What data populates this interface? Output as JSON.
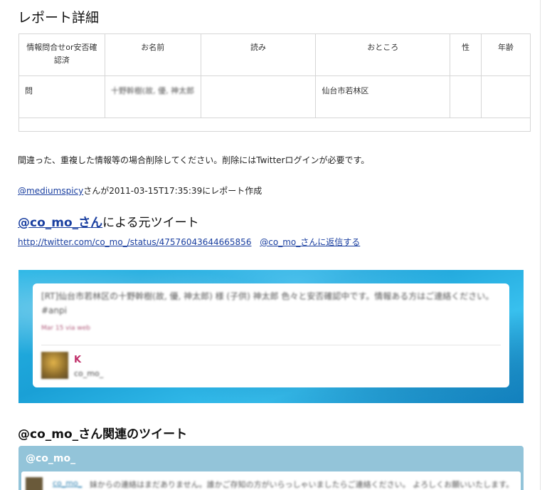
{
  "page_title": "レポート詳細",
  "report_table": {
    "headers": [
      "情報問合せor安否確認済",
      "お名前",
      "読み",
      "おところ",
      "性",
      "年齢"
    ],
    "row": [
      "問",
      "十野幹樹(故, 優, 神太郎",
      "",
      "仙台市若林区",
      "",
      ""
    ]
  },
  "note": "間違った、重複した情報等の場合削除してください。削除にはTwitterログインが必要です。",
  "byline": {
    "user": "@mediumspicy",
    "suffix": "さんが2011-03-15T17:35:39にレポート作成"
  },
  "original": {
    "handle": "@co_mo_さん",
    "rest": "による元ツイート",
    "status_url": "http://twitter.com/co_mo_/status/47576043644665856",
    "reply_link": "@co_mo_さんに返信する"
  },
  "embedded_tweet": {
    "text": "[RT]仙台市若林区の十野幹樹(故, 優, 神太郎) 様 (子供) 神太郎 色々と安否確認中です。情報ある方はご連絡ください。#anpi",
    "meta": "Mar 15 via web",
    "name": "K",
    "handle": "co_mo_"
  },
  "related": {
    "heading": "@co_mo_さん関連のツイート",
    "box_title": "@co_mo_",
    "row_user": "co_mo_",
    "row_text": "妹からの連絡はまだありません。誰かご存知の方がいらっしゃいましたらご連絡ください。 よろしくお願いいたします。"
  },
  "colors": {
    "link": "#1a3fa0",
    "tweet_name": "#c0306a",
    "related_header": "#93c4d9",
    "banner": "#1aa0d6"
  }
}
